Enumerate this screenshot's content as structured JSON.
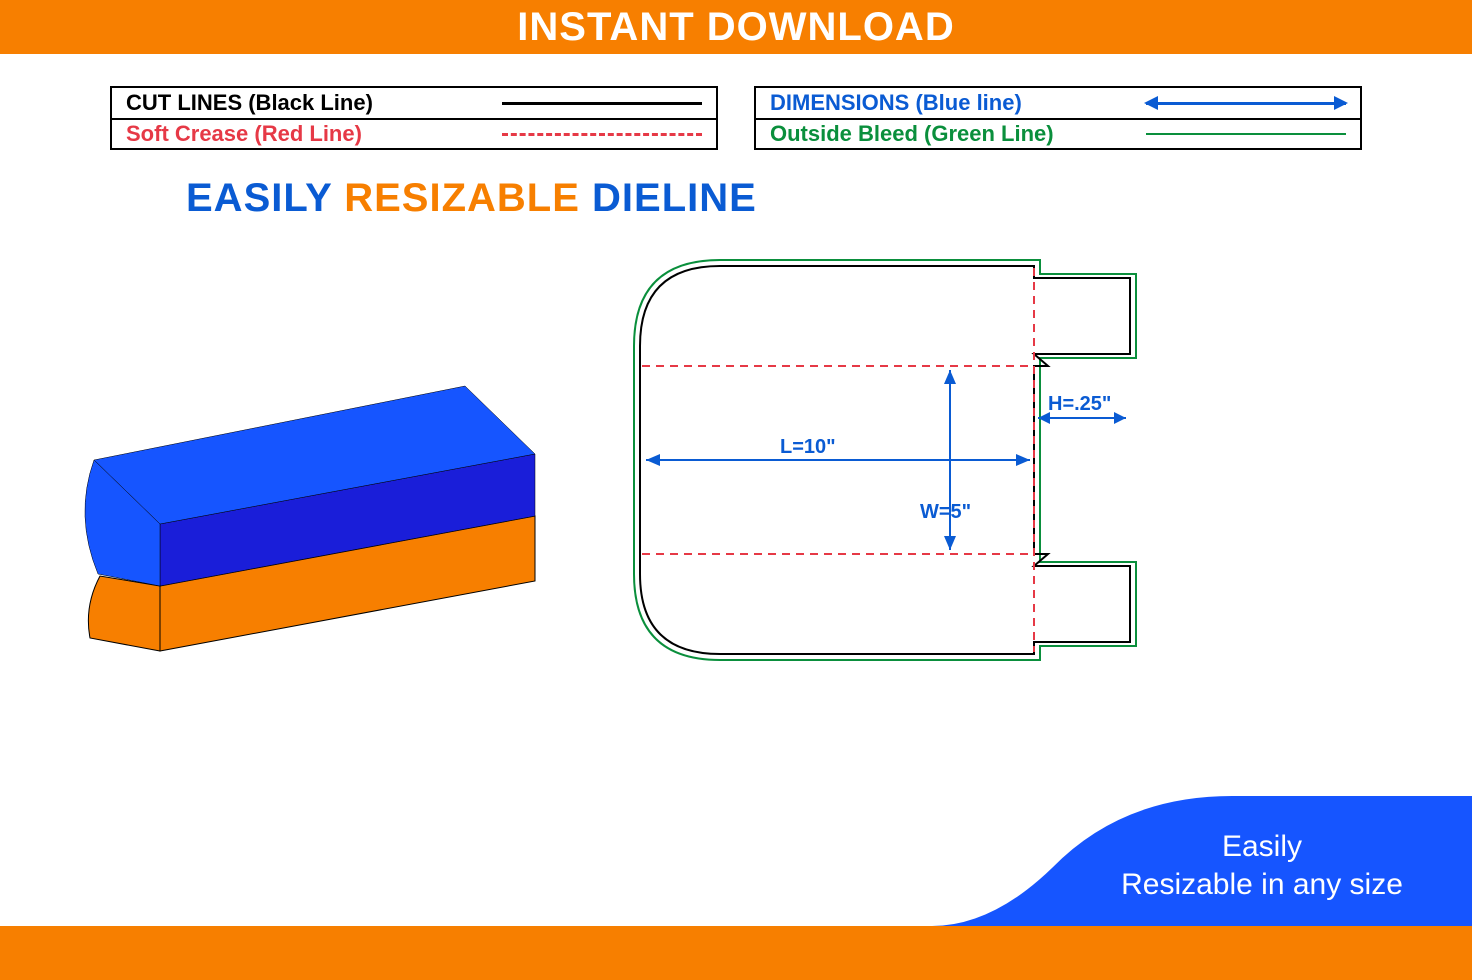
{
  "banner": {
    "title": "INSTANT DOWNLOAD"
  },
  "legend": {
    "cut": {
      "label": "CUT LINES (Black Line)"
    },
    "crease": {
      "label": "Soft Crease (Red Line)"
    },
    "dim": {
      "label": "DIMENSIONS (Blue line)"
    },
    "bleed": {
      "label": "Outside Bleed (Green Line)"
    }
  },
  "subhead": {
    "w1": "EASILY",
    "w2": "RESIZABLE",
    "w3": "DIELINE"
  },
  "dims": {
    "L": "L=10\"",
    "W": "W=5\"",
    "H": "H=.25\""
  },
  "footer": {
    "line1": "Easily",
    "line2": "Resizable in any size"
  }
}
